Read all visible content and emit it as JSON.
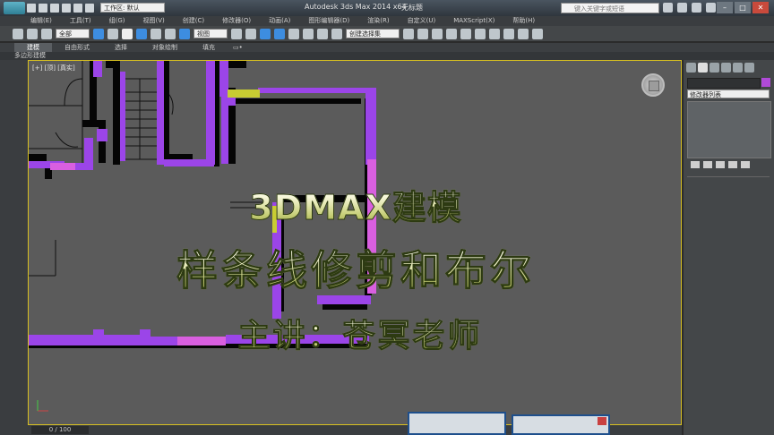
{
  "titlebar": {
    "app_title": "Autodesk 3ds Max  2014 x64",
    "file_name": "无标题",
    "workspace": "工作区: 默认",
    "search_placeholder": "键入关键字或短语"
  },
  "menu": [
    "编辑(E)",
    "工具(T)",
    "组(G)",
    "视图(V)",
    "创建(C)",
    "修改器(O)",
    "动画(A)",
    "图形编辑器(D)",
    "渲染(R)",
    "自定义(U)",
    "MAXScript(X)",
    "帮助(H)"
  ],
  "toolbar": {
    "selection_filter": "全部",
    "ref_coord": "视图",
    "named_selection": "创建选择集"
  },
  "ribbon": {
    "tabs": [
      "建模",
      "自由形式",
      "选择",
      "对象绘制",
      "填充"
    ],
    "active_tab": "建模",
    "sub_label": "多边形建模"
  },
  "viewport": {
    "label": "[+] [顶] [真实]"
  },
  "overlay": {
    "line1": "3DMAX建模",
    "line2": "样条线修剪和布尔",
    "line3": "主讲：苍冥老师"
  },
  "command_panel": {
    "modifier_list": "修改器列表"
  },
  "timeline": {
    "frame": "0 / 100"
  },
  "colors": {
    "wall_purple": "#9b45e8",
    "wall_pink": "#d95fe0",
    "accent_yellow": "#c8cc32",
    "viewport_bg": "#5b5b5b"
  }
}
